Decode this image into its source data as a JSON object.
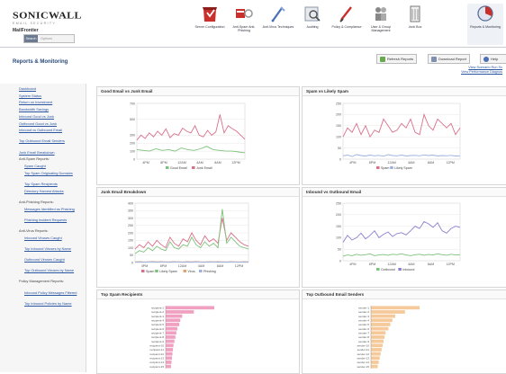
{
  "brand": {
    "name": "SONICWALL",
    "sub": "EMAIL SECURITY",
    "product": "MailFrontier"
  },
  "search": {
    "button": "Search",
    "placeholder": "Options"
  },
  "nav": [
    {
      "id": "server-config",
      "label": "Server Configuration",
      "icon": "server-config-icon"
    },
    {
      "id": "anti-spam",
      "label": "Anti-Spam Anti-Phishing",
      "icon": "anti-spam-icon"
    },
    {
      "id": "anti-virus",
      "label": "Anti-Virus Techniques",
      "icon": "anti-virus-icon"
    },
    {
      "id": "auditing",
      "label": "Auditing",
      "icon": "auditing-icon"
    },
    {
      "id": "policy",
      "label": "Policy & Compliance",
      "icon": "policy-icon"
    },
    {
      "id": "user-group",
      "label": "User & Group Management",
      "icon": "user-group-icon"
    },
    {
      "id": "junk-box",
      "label": "Junk Box",
      "icon": "junk-box-icon"
    },
    {
      "id": "reports",
      "label": "Reports & Monitoring",
      "icon": "reports-icon",
      "active": true
    }
  ],
  "section": {
    "title": "Reports & Monitoring",
    "refresh": "Refresh Reports",
    "download": "Download Report",
    "help": "Help",
    "link1": "View Scenario Run Sc",
    "link2": "View Performance Diagnos"
  },
  "sidebar": [
    {
      "label": "Dashboard",
      "type": "link"
    },
    {
      "label": "System Status",
      "type": "link"
    },
    {
      "label": "Return on Investment",
      "type": "link"
    },
    {
      "label": "Bandwidth Savings",
      "type": "link"
    },
    {
      "label": "Inbound Good vs Junk",
      "type": "link"
    },
    {
      "label": "Outbound Good vs Junk",
      "type": "link"
    },
    {
      "label": "Inbound vs Outbound Email",
      "type": "link"
    },
    {
      "label": "Top Outbound Email Senders",
      "type": "link"
    },
    {
      "label": "Junk Email Breakdown",
      "type": "link"
    },
    {
      "label": "Anti-Spam Reports:",
      "type": "header"
    },
    {
      "label": "Spam Caught",
      "type": "sub"
    },
    {
      "label": "Top Spam Originating Domains",
      "type": "sub"
    },
    {
      "label": "Top Spam Recipients",
      "type": "sub"
    },
    {
      "label": "Directory Harvest Attacks",
      "type": "sub"
    },
    {
      "label": "Anti-Phishing Reports:",
      "type": "header"
    },
    {
      "label": "Messages Identified as Phishing",
      "type": "sub"
    },
    {
      "label": "Phishing Incident Requests",
      "type": "sub"
    },
    {
      "label": "Anti-Virus Reports:",
      "type": "header"
    },
    {
      "label": "Inbound Viruses Caught",
      "type": "sub"
    },
    {
      "label": "Top Inbound Viruses by Name",
      "type": "sub"
    },
    {
      "label": "Outbound Viruses Caught",
      "type": "sub"
    },
    {
      "label": "Top Outbound Viruses by Name",
      "type": "sub"
    },
    {
      "label": "Policy Management Reports:",
      "type": "header"
    },
    {
      "label": "Inbound Policy Messages Filtered",
      "type": "sub"
    },
    {
      "label": "Top Inbound Policies by Name",
      "type": "sub"
    }
  ],
  "xticks": [
    "4PM",
    "8PM",
    "12AM",
    "4AM",
    "8AM",
    "12PM"
  ],
  "chart_data": [
    {
      "type": "line",
      "title": "Good Email vs Junk Email",
      "ylim": [
        0,
        700
      ],
      "yticks": [
        0,
        100,
        200,
        300,
        500,
        700
      ],
      "series": [
        {
          "name": "Good Email",
          "color": "#7dc27a",
          "values": [
            120,
            110,
            100,
            130,
            110,
            120,
            100,
            140,
            120,
            110,
            130,
            160,
            120,
            110,
            100,
            100,
            90,
            80
          ]
        },
        {
          "name": "Junk Email",
          "color": "#d9708a",
          "values": [
            240,
            300,
            260,
            330,
            280,
            350,
            300,
            380,
            270,
            320,
            300,
            390,
            350,
            330,
            420,
            300,
            280,
            360,
            300,
            340,
            560,
            330,
            420,
            380,
            350,
            300,
            250
          ]
        }
      ]
    },
    {
      "type": "line",
      "title": "Spam vs Likely Spam",
      "ylim": [
        0,
        250
      ],
      "yticks": [
        0,
        50,
        100,
        150,
        200,
        250
      ],
      "series": [
        {
          "name": "Spam",
          "color": "#d9708a",
          "values": [
            100,
            140,
            120,
            160,
            110,
            150,
            100,
            130,
            120,
            180,
            150,
            120,
            130,
            160,
            140,
            180,
            120,
            110,
            200,
            150,
            130,
            180,
            160,
            140,
            160,
            110,
            140
          ]
        },
        {
          "name": "Likely Spam",
          "color": "#9ab0e0",
          "values": [
            15,
            18,
            12,
            20,
            16,
            14,
            18,
            15,
            17,
            13,
            20,
            16,
            15,
            18,
            14,
            16,
            17,
            15,
            19,
            16,
            18,
            14,
            16,
            15,
            17,
            14,
            15
          ]
        }
      ]
    },
    {
      "type": "line",
      "title": "Junk Email Breakdown",
      "ylim": [
        0,
        400
      ],
      "yticks": [
        0,
        50,
        100,
        150,
        200,
        250,
        300,
        350,
        400
      ],
      "series": [
        {
          "name": "Spam",
          "color": "#d9708a",
          "values": [
            90,
            120,
            100,
            140,
            110,
            150,
            120,
            100,
            170,
            130,
            110,
            160,
            140,
            200,
            150,
            120,
            180,
            140,
            160,
            130,
            300,
            150,
            200,
            170,
            140,
            120,
            110
          ]
        },
        {
          "name": "Likely Spam",
          "color": "#7dc27a",
          "values": [
            60,
            80,
            70,
            100,
            80,
            110,
            90,
            80,
            140,
            100,
            90,
            120,
            110,
            170,
            120,
            100,
            140,
            110,
            130,
            100,
            360,
            130,
            170,
            140,
            110,
            100,
            90
          ]
        },
        {
          "name": "Virus",
          "color": "#e6a36b",
          "values": [
            5,
            6,
            4,
            5,
            7,
            5,
            6,
            4,
            5,
            6,
            5,
            4,
            6,
            5,
            7,
            5,
            4,
            6,
            5,
            6,
            5,
            4,
            6,
            5,
            4,
            6,
            5
          ]
        },
        {
          "name": "Phishing",
          "color": "#9ab0e0",
          "values": [
            3,
            4,
            3,
            5,
            4,
            3,
            5,
            4,
            3,
            4,
            5,
            3,
            4,
            3,
            5,
            4,
            3,
            4,
            5,
            3,
            4,
            3,
            5,
            4,
            3,
            4,
            3
          ]
        }
      ]
    },
    {
      "type": "line",
      "title": "Inbound vs Outbound Email",
      "ylim": [
        0,
        250
      ],
      "yticks": [
        0,
        50,
        100,
        150,
        200,
        250
      ],
      "series": [
        {
          "name": "Outbound",
          "color": "#7dc27a",
          "values": [
            20,
            25,
            22,
            28,
            24,
            26,
            30,
            22,
            25,
            27,
            24,
            28,
            26,
            30,
            25,
            22,
            26,
            28,
            24,
            27,
            25,
            30,
            26,
            24,
            28,
            25,
            26
          ]
        },
        {
          "name": "Inbound",
          "color": "#8b7fd0",
          "values": [
            80,
            110,
            90,
            100,
            120,
            95,
            110,
            130,
            100,
            115,
            125,
            105,
            118,
            122,
            112,
            130,
            150,
            140,
            170,
            160,
            145,
            165,
            130,
            120,
            140,
            150,
            145
          ]
        }
      ]
    },
    {
      "type": "bar",
      "title": "Top Spam Recipients",
      "color": "#f0a0c0",
      "categories": [
        "recipient-1",
        "recipient-2",
        "recipient-3",
        "recipient-4",
        "recipient-5",
        "recipient-6",
        "recipient-7",
        "recipient-8",
        "recipient-9",
        "recipient-10",
        "recipient-11",
        "recipient-12",
        "recipient-13",
        "recipient-14",
        "recipient-15"
      ],
      "values": [
        100,
        58,
        34,
        30,
        28,
        24,
        22,
        20,
        18,
        16,
        15,
        14,
        13,
        12,
        11
      ]
    },
    {
      "type": "bar",
      "title": "Top Outbound Email Senders",
      "color": "#f5c99a",
      "categories": [
        "sender-1",
        "sender-2",
        "sender-3",
        "sender-4",
        "sender-5",
        "sender-6",
        "sender-7",
        "sender-8",
        "sender-9",
        "sender-10",
        "sender-11",
        "sender-12",
        "sender-13",
        "sender-14",
        "sender-15"
      ],
      "values": [
        100,
        70,
        50,
        44,
        40,
        36,
        30,
        28,
        26,
        24,
        22,
        20,
        18,
        16,
        14
      ]
    }
  ]
}
